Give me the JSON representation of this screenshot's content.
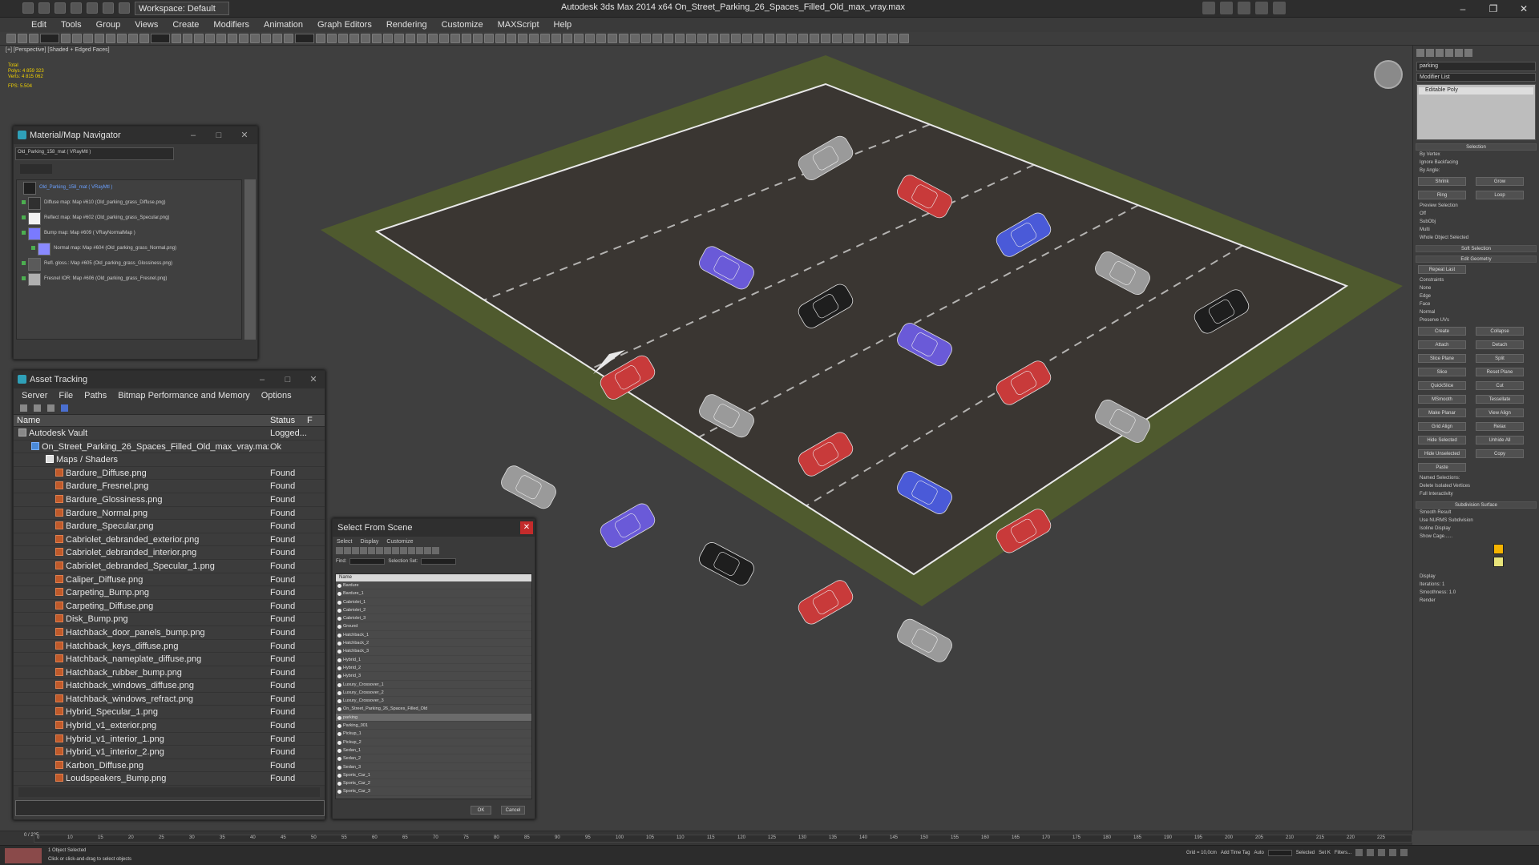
{
  "app": {
    "workspace": "Workspace: Default",
    "window_title": "Autodesk 3ds Max  2014 x64     On_Street_Parking_26_Spaces_Filled_Old_max_vray.max"
  },
  "menu": [
    "Edit",
    "Tools",
    "Group",
    "Views",
    "Create",
    "Modifiers",
    "Animation",
    "Graph Editors",
    "Rendering",
    "Customize",
    "MAXScript",
    "Help"
  ],
  "viewport": {
    "label": "[+] [Perspective] [Shaded + Edged Faces]",
    "stats": [
      "Total",
      "Polys:  4 859 323",
      "Verts:  4 815 062",
      "FPS:    5.504"
    ]
  },
  "material_navigator": {
    "title": "Material/Map Navigator",
    "field": "Old_Parking_158_mat  ( VRayMtl )",
    "nodes": [
      {
        "label": "Old_Parking_158_mat  ( VRayMtl )",
        "swatch": "#202020"
      },
      {
        "label": "Diffuse map: Map #610 (Old_parking_grass_Diffuse.png)",
        "swatch": "#303030"
      },
      {
        "label": "Reflect map: Map #602 (Old_parking_grass_Specular.png)",
        "swatch": "#f2f2f2"
      },
      {
        "label": "Bump map: Map #609  ( VRayNormalMap )",
        "swatch": "#7a7aff"
      },
      {
        "label": "Normal map: Map #604 (Old_parking_grass_Normal.png)",
        "swatch": "#8a8aff"
      },
      {
        "label": "Refl. gloss.: Map #605 (Old_parking_grass_Glossiness.png)",
        "swatch": "#5a5a5a"
      },
      {
        "label": "Fresnel IOR: Map #606 (Old_parking_grass_Fresnel.png)",
        "swatch": "#b0b0b0"
      }
    ]
  },
  "asset_tracking": {
    "title": "Asset Tracking",
    "menu": [
      "Server",
      "File",
      "Paths",
      "Bitmap Performance and Memory",
      "Options"
    ],
    "columns": [
      "Name",
      "Status",
      "F"
    ],
    "rows": [
      {
        "name": "Autodesk Vault",
        "status": "Logged...",
        "level": 1
      },
      {
        "name": "On_Street_Parking_26_Spaces_Filled_Old_max_vray.max",
        "status": "Ok",
        "level": 2
      },
      {
        "name": "Maps / Shaders",
        "status": "",
        "level": 3
      },
      {
        "name": "Bardure_Diffuse.png",
        "status": "Found",
        "level": 4
      },
      {
        "name": "Bardure_Fresnel.png",
        "status": "Found",
        "level": 4
      },
      {
        "name": "Bardure_Glossiness.png",
        "status": "Found",
        "level": 4
      },
      {
        "name": "Bardure_Normal.png",
        "status": "Found",
        "level": 4
      },
      {
        "name": "Bardure_Specular.png",
        "status": "Found",
        "level": 4
      },
      {
        "name": "Cabriolet_debranded_exterior.png",
        "status": "Found",
        "level": 4
      },
      {
        "name": "Cabriolet_debranded_interior.png",
        "status": "Found",
        "level": 4
      },
      {
        "name": "Cabriolet_debranded_Specular_1.png",
        "status": "Found",
        "level": 4
      },
      {
        "name": "Caliper_Diffuse.png",
        "status": "Found",
        "level": 4
      },
      {
        "name": "Carpeting_Bump.png",
        "status": "Found",
        "level": 4
      },
      {
        "name": "Carpeting_Diffuse.png",
        "status": "Found",
        "level": 4
      },
      {
        "name": "Disk_Bump.png",
        "status": "Found",
        "level": 4
      },
      {
        "name": "Hatchback_door_panels_bump.png",
        "status": "Found",
        "level": 4
      },
      {
        "name": "Hatchback_keys_diffuse.png",
        "status": "Found",
        "level": 4
      },
      {
        "name": "Hatchback_nameplate_diffuse.png",
        "status": "Found",
        "level": 4
      },
      {
        "name": "Hatchback_rubber_bump.png",
        "status": "Found",
        "level": 4
      },
      {
        "name": "Hatchback_windows_diffuse.png",
        "status": "Found",
        "level": 4
      },
      {
        "name": "Hatchback_windows_refract.png",
        "status": "Found",
        "level": 4
      },
      {
        "name": "Hybrid_Specular_1.png",
        "status": "Found",
        "level": 4
      },
      {
        "name": "Hybrid_v1_exterior.png",
        "status": "Found",
        "level": 4
      },
      {
        "name": "Hybrid_v1_interior_1.png",
        "status": "Found",
        "level": 4
      },
      {
        "name": "Hybrid_v1_interior_2.png",
        "status": "Found",
        "level": 4
      },
      {
        "name": "Karbon_Diffuse.png",
        "status": "Found",
        "level": 4
      },
      {
        "name": "Loudspeakers_Bump.png",
        "status": "Found",
        "level": 4
      }
    ]
  },
  "select_from_scene": {
    "title": "Select From Scene",
    "menu": [
      "Select",
      "Display",
      "Customize"
    ],
    "find_label": "Find:",
    "selection_set_label": "Selection Set:",
    "list_header": "Name",
    "items": [
      "Bardure",
      "Bardure_1",
      "Cabriolet_1",
      "Cabriolet_2",
      "Cabriolet_3",
      "Ground",
      "Hatchback_1",
      "Hatchback_2",
      "Hatchback_3",
      "Hybrid_1",
      "Hybrid_2",
      "Hybrid_3",
      "Luxury_Crossover_1",
      "Luxury_Crossover_2",
      "Luxury_Crossover_3",
      "On_Street_Parking_26_Spaces_Filled_Old",
      "parking",
      "Parking_001",
      "Pickup_1",
      "Pickup_2",
      "Sedan_1",
      "Sedan_2",
      "Sedan_3",
      "Sports_Car_1",
      "Sports_Car_2",
      "Sports_Car_3"
    ],
    "highlighted": "parking",
    "ok": "OK",
    "cancel": "Cancel"
  },
  "command_panel": {
    "object_name": "parking",
    "modifier_list": "Modifier List",
    "stack_item": "Editable Poly",
    "rollouts": [
      "Selection",
      "Soft Selection",
      "Edit Geometry",
      "Subdivision Surface"
    ],
    "buttons": [
      "Shrink",
      "Grow",
      "Ring",
      "Loop",
      "Repeat Last",
      "Create",
      "Collapse",
      "Attach",
      "Detach",
      "Slice Plane",
      "Split",
      "Slice",
      "Reset Plane",
      "QuickSlice",
      "Cut",
      "MSmooth",
      "Tessellate",
      "Make Planar",
      "View Align",
      "Grid Align",
      "Relax",
      "Hide Selected",
      "Unhide All",
      "Hide Unselected",
      "Copy",
      "Paste"
    ],
    "labels": [
      "By Vertex",
      "Ignore Backfacing",
      "By Angle:",
      "Preview Selection",
      "Off",
      "SubObj",
      "Multi",
      "Whole Object Selected",
      "Constraints",
      "None",
      "Edge",
      "Face",
      "Normal",
      "Preserve UVs",
      "Named Selections:",
      "Delete Isolated Vertices",
      "Full Interactivity",
      "Smooth Result",
      "Use NURMS Subdivision",
      "Isoline Display",
      "Show Cage......",
      "Display",
      "Iterations:",
      "Smoothness:",
      "Render"
    ],
    "iterations": "1",
    "smoothness": "1.0",
    "cage_colors": [
      "#f5b400",
      "#e8e47a"
    ]
  },
  "timeline": {
    "frame_display": "0 / 225",
    "ticks": [
      "0",
      "10",
      "15",
      "20",
      "25",
      "30",
      "35",
      "40",
      "45",
      "50",
      "55",
      "60",
      "65",
      "70",
      "75",
      "80",
      "85",
      "90",
      "95",
      "100",
      "105",
      "110",
      "115",
      "120",
      "125",
      "130",
      "135",
      "140",
      "145",
      "150",
      "155",
      "160",
      "165",
      "170",
      "175",
      "180",
      "185",
      "190",
      "195",
      "200",
      "205",
      "210",
      "215",
      "220",
      "225"
    ]
  },
  "statusbar": {
    "line1": "1 Object Selected",
    "line2": "Click or click-and-drag to select objects",
    "grid": "Grid = 10,0cm",
    "auto": "Auto",
    "set_key": "Set K",
    "selected": "Selected",
    "add_time_tag": "Add Time Tag",
    "filters": "Filters..."
  },
  "scene": {
    "colors": {
      "grass": "#4f5a2e",
      "asphalt": "#3a3632",
      "line": "#e8e8e8",
      "red": "#c83a3a",
      "blue": "#4a5ad8",
      "purple": "#6a5ad8",
      "gray": "#9a9a9a",
      "dark": "#1e1e1e"
    },
    "cars": [
      {
        "color": "gray"
      },
      {
        "color": "red"
      },
      {
        "color": "blue"
      },
      {
        "color": "gray"
      },
      {
        "color": "dark"
      },
      {
        "color": "purple"
      },
      {
        "color": "dark"
      },
      {
        "color": "purple"
      },
      {
        "color": "red"
      },
      {
        "color": "gray"
      },
      {
        "color": "red"
      },
      {
        "color": "gray"
      },
      {
        "color": "red"
      },
      {
        "color": "blue"
      },
      {
        "color": "red"
      },
      {
        "color": "gray"
      },
      {
        "color": "purple"
      },
      {
        "color": "dark"
      },
      {
        "color": "red"
      },
      {
        "color": "gray"
      }
    ]
  }
}
